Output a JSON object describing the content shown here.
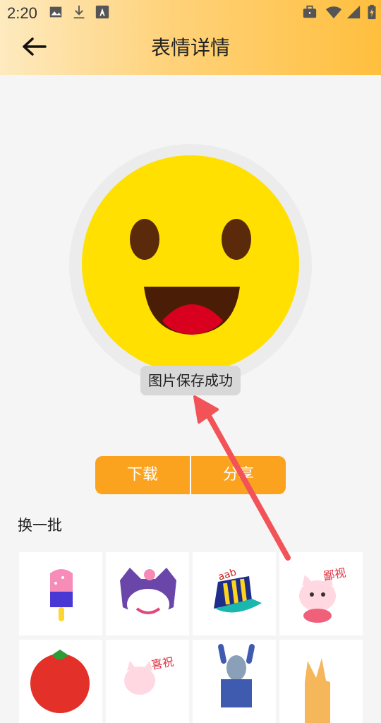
{
  "status_bar": {
    "time": "2:20"
  },
  "header": {
    "title": "表情详情"
  },
  "toast": {
    "text": "图片保存成功"
  },
  "actions": {
    "download": "下载",
    "share": "分享"
  },
  "grid": {
    "refresh_label": "换一批",
    "stickers": [
      {
        "name": "ice-pop"
      },
      {
        "name": "kuromi"
      },
      {
        "name": "cap"
      },
      {
        "name": "cat-congrats",
        "text": "鄙视"
      },
      {
        "name": "tomato"
      },
      {
        "name": "cat-congrats-2",
        "text": "喜祝"
      },
      {
        "name": "robot"
      },
      {
        "name": "hand-peace"
      }
    ]
  },
  "colors": {
    "accent": "#fba31e",
    "arrow": "#f25358"
  }
}
